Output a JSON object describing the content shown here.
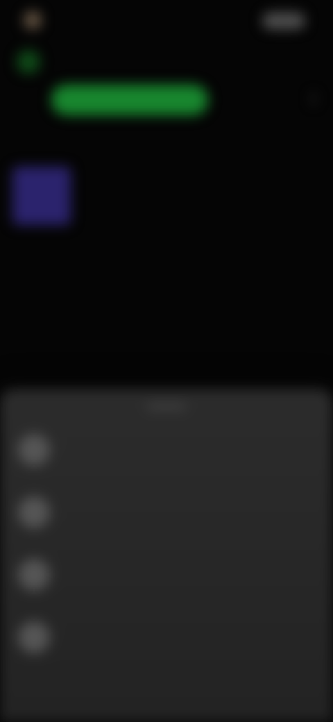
{
  "topBar": {
    "title": "",
    "action_label": ""
  },
  "header": {
    "text": "",
    "primary_button_label": ""
  },
  "media": {
    "title": "",
    "subtitle": ""
  },
  "sheet": {
    "title": "",
    "options": [
      {
        "label": "",
        "description": ""
      },
      {
        "label": "",
        "description": ""
      },
      {
        "label": "",
        "description": ""
      },
      {
        "label": "",
        "description": ""
      }
    ]
  },
  "icons": {
    "top_avatar": "avatar-icon",
    "green_badge": "badge-icon",
    "more": "more-vertical-icon",
    "media": "media-art-icon",
    "option_icons": [
      "round-option-icon",
      "round-option-icon",
      "round-option-icon",
      "round-option-icon"
    ]
  },
  "colors": {
    "background": "#050505",
    "green": "#18862e",
    "purple": "#2b236d",
    "sheet": "#2a2a2a"
  }
}
